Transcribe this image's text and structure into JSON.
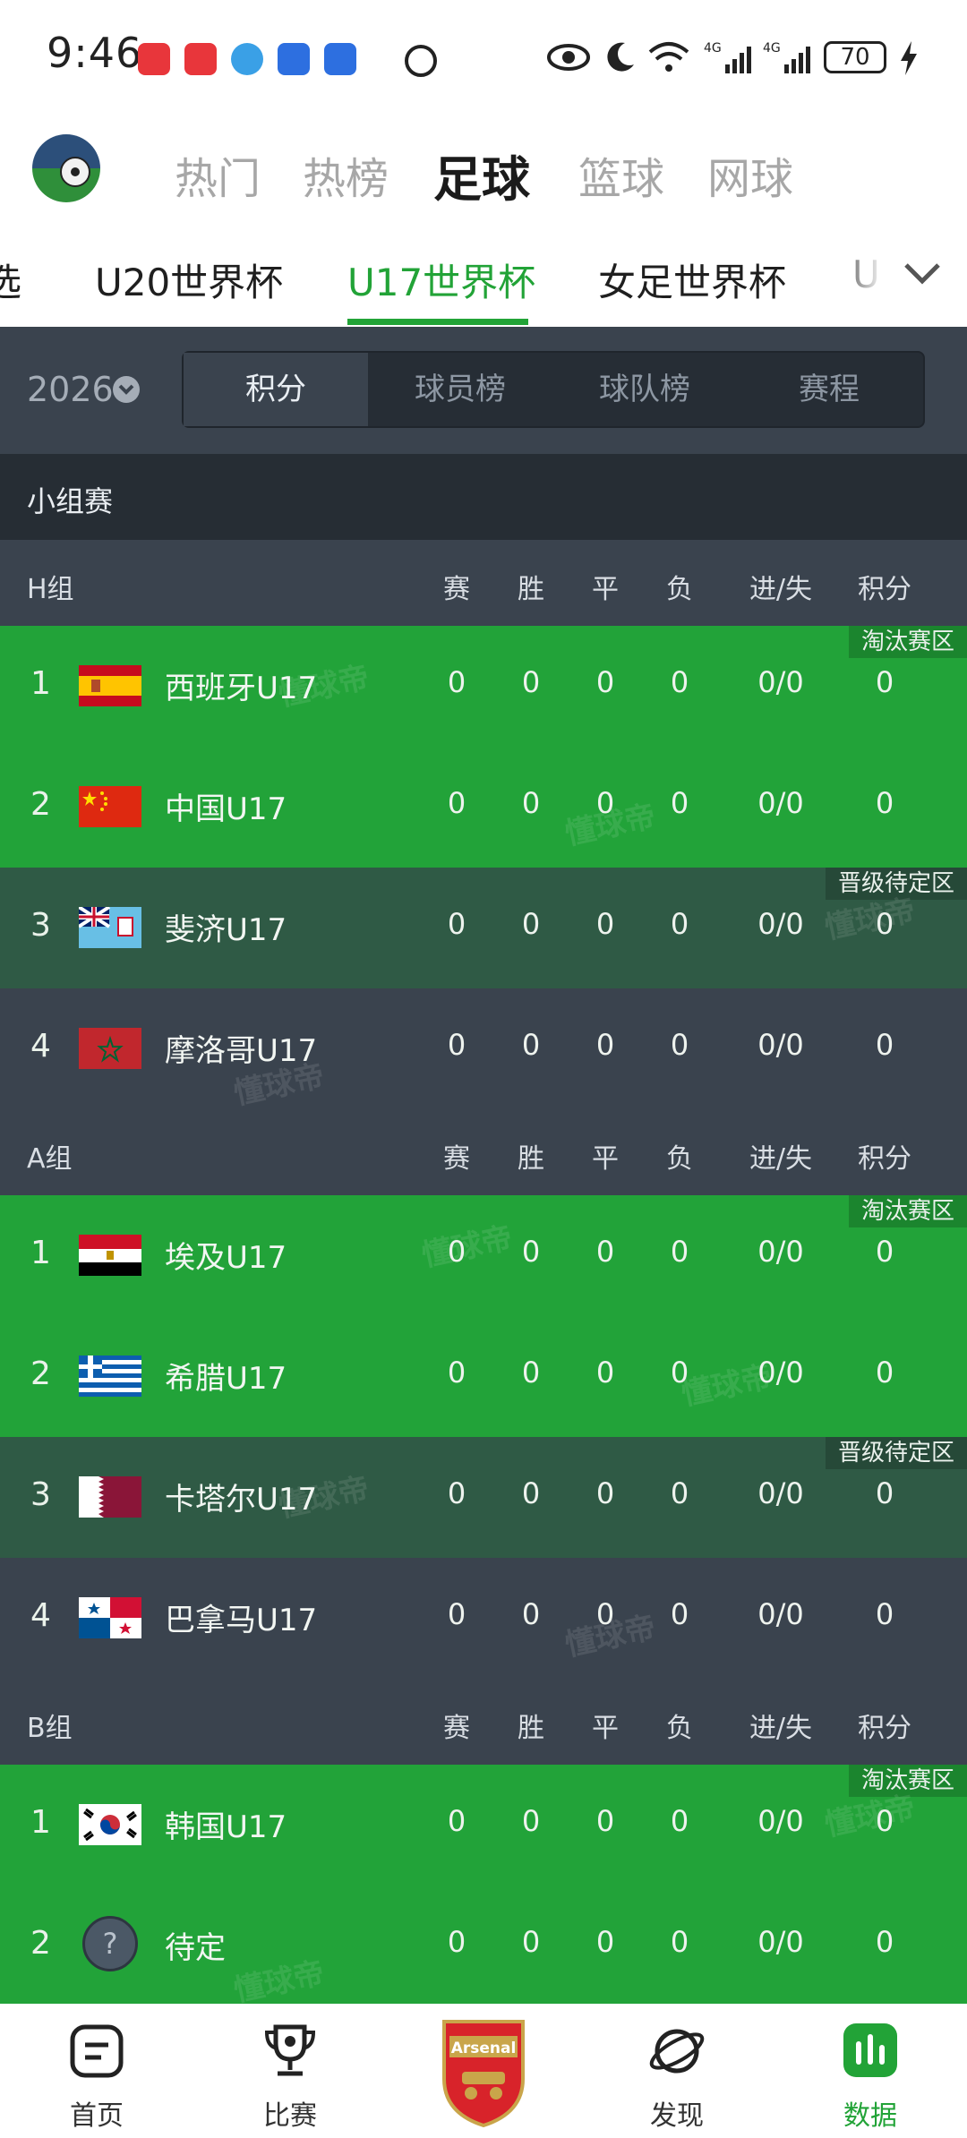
{
  "status_bar": {
    "time": "9:46",
    "battery": "70"
  },
  "header": {
    "sports": [
      "热门",
      "热榜",
      "足球",
      "篮球",
      "网球"
    ],
    "active_sport": "足球"
  },
  "league_tabs": {
    "items": [
      "选",
      "U20世界杯",
      "U17世界杯",
      "女足世界杯",
      "U"
    ],
    "active": "U17世界杯"
  },
  "filter": {
    "season": "2026",
    "tabs": [
      "积分",
      "球员榜",
      "球队榜",
      "赛程"
    ],
    "active_tab": "积分"
  },
  "stage": "小组赛",
  "columns": [
    "赛",
    "胜",
    "平",
    "负",
    "进/失",
    "积分"
  ],
  "groups": [
    {
      "name": "H组",
      "rows": [
        {
          "rank": "1",
          "team": "西班牙U17",
          "flag": "spain",
          "p": "0",
          "w": "0",
          "d": "0",
          "l": "0",
          "gf_ga": "0/0",
          "pts": "0",
          "zone": "淘汰赛区",
          "tone": "green"
        },
        {
          "rank": "2",
          "team": "中国U17",
          "flag": "china",
          "p": "0",
          "w": "0",
          "d": "0",
          "l": "0",
          "gf_ga": "0/0",
          "pts": "0",
          "zone": "",
          "tone": "green"
        },
        {
          "rank": "3",
          "team": "斐济U17",
          "flag": "fiji",
          "p": "0",
          "w": "0",
          "d": "0",
          "l": "0",
          "gf_ga": "0/0",
          "pts": "0",
          "zone": "晋级待定区",
          "tone": "dkgreen"
        },
        {
          "rank": "4",
          "team": "摩洛哥U17",
          "flag": "morocco",
          "p": "0",
          "w": "0",
          "d": "0",
          "l": "0",
          "gf_ga": "0/0",
          "pts": "0",
          "zone": "",
          "tone": "grey"
        }
      ]
    },
    {
      "name": "A组",
      "rows": [
        {
          "rank": "1",
          "team": "埃及U17",
          "flag": "egypt",
          "p": "0",
          "w": "0",
          "d": "0",
          "l": "0",
          "gf_ga": "0/0",
          "pts": "0",
          "zone": "淘汰赛区",
          "tone": "green"
        },
        {
          "rank": "2",
          "team": "希腊U17",
          "flag": "greece",
          "p": "0",
          "w": "0",
          "d": "0",
          "l": "0",
          "gf_ga": "0/0",
          "pts": "0",
          "zone": "",
          "tone": "green"
        },
        {
          "rank": "3",
          "team": "卡塔尔U17",
          "flag": "qatar",
          "p": "0",
          "w": "0",
          "d": "0",
          "l": "0",
          "gf_ga": "0/0",
          "pts": "0",
          "zone": "晋级待定区",
          "tone": "dkgreen"
        },
        {
          "rank": "4",
          "team": "巴拿马U17",
          "flag": "panama",
          "p": "0",
          "w": "0",
          "d": "0",
          "l": "0",
          "gf_ga": "0/0",
          "pts": "0",
          "zone": "",
          "tone": "grey"
        }
      ]
    },
    {
      "name": "B组",
      "rows": [
        {
          "rank": "1",
          "team": "韩国U17",
          "flag": "korea",
          "p": "0",
          "w": "0",
          "d": "0",
          "l": "0",
          "gf_ga": "0/0",
          "pts": "0",
          "zone": "淘汰赛区",
          "tone": "green"
        },
        {
          "rank": "2",
          "team": "待定",
          "flag": "unknown",
          "p": "0",
          "w": "0",
          "d": "0",
          "l": "0",
          "gf_ga": "0/0",
          "pts": "0",
          "zone": "",
          "tone": "green"
        }
      ]
    }
  ],
  "bottom_nav": {
    "items": [
      "首页",
      "比赛",
      "",
      "发现",
      "数据"
    ],
    "active": "数据",
    "center_badge": "Arsenal"
  },
  "watermark": "懂球帝",
  "colors": {
    "accent": "#22a337",
    "qualify_row": "#22a339",
    "pending_row": "#2f5a45",
    "neutral_row": "#3a434e"
  }
}
